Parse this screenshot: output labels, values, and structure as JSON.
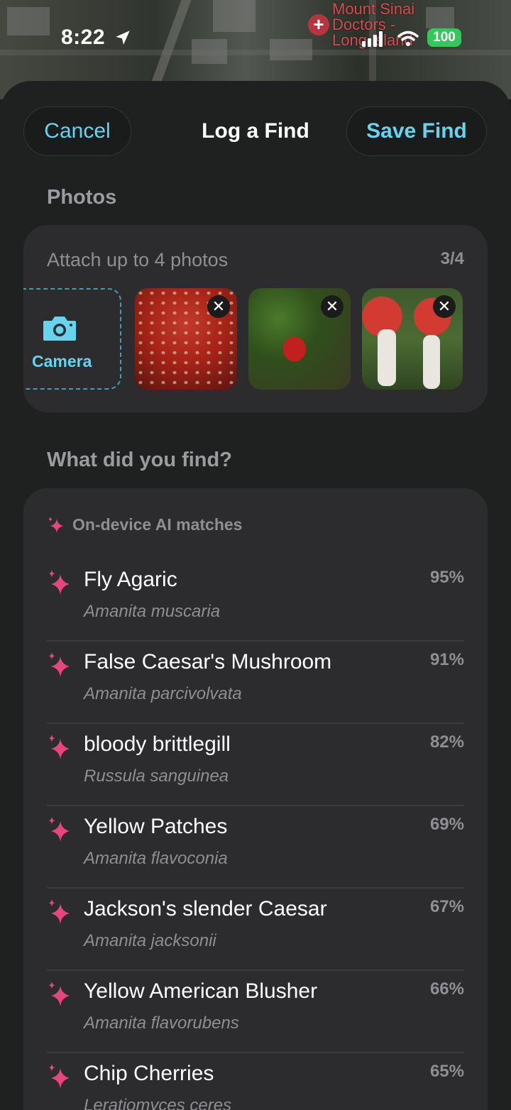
{
  "status_bar": {
    "time": "8:22",
    "battery": "100"
  },
  "map": {
    "poi_label": "Mount Sinai Doctors - Long Island"
  },
  "header": {
    "cancel_label": "Cancel",
    "title": "Log a Find",
    "save_label": "Save Find"
  },
  "photos": {
    "section_title": "Photos",
    "hint": "Attach up to 4 photos",
    "count": "3/4",
    "camera_label": "Camera",
    "thumbnails": [
      "mushroom photo 1",
      "mushroom photo 2",
      "mushroom photo 3"
    ]
  },
  "identify": {
    "section_title": "What did you find?",
    "ai_header": "On-device AI matches",
    "matches": [
      {
        "common": "Fly Agaric",
        "scientific": "Amanita muscaria",
        "confidence": "95%"
      },
      {
        "common": "False Caesar's Mushroom",
        "scientific": "Amanita parcivolvata",
        "confidence": "91%"
      },
      {
        "common": "bloody brittlegill",
        "scientific": "Russula sanguinea",
        "confidence": "82%"
      },
      {
        "common": "Yellow Patches",
        "scientific": "Amanita flavoconia",
        "confidence": "69%"
      },
      {
        "common": "Jackson's slender Caesar",
        "scientific": "Amanita jacksonii",
        "confidence": "67%"
      },
      {
        "common": "Yellow American Blusher",
        "scientific": "Amanita flavorubens",
        "confidence": "66%"
      },
      {
        "common": "Chip Cherries",
        "scientific": "Leratiomyces ceres",
        "confidence": "65%"
      }
    ]
  },
  "colors": {
    "accent": "#66d4ee",
    "sparkle": "#e8457f",
    "background": "#1f2020",
    "card": "#2c2c2e",
    "secondary_text": "#8e8e93"
  },
  "icons": {
    "location": "location-arrow-icon",
    "camera": "camera-icon",
    "remove": "close-icon",
    "ai": "sparkle-icon"
  }
}
